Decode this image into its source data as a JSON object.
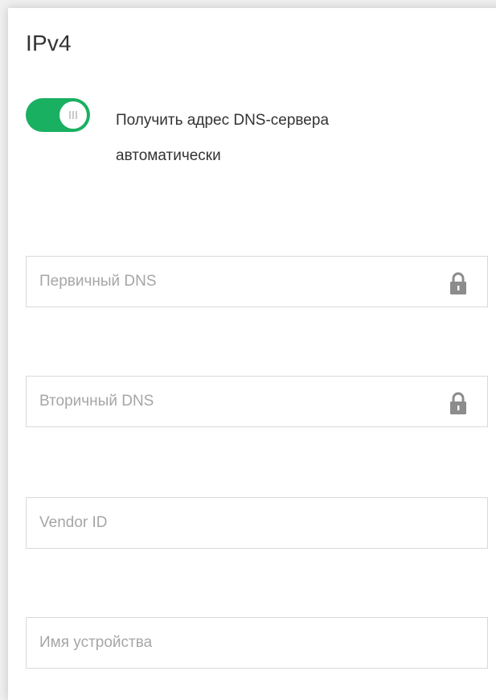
{
  "section": {
    "title": "IPv4"
  },
  "auto_dns": {
    "label": "Получить адрес DNS-сервера автоматически",
    "enabled": true,
    "accent_color": "#1ab061"
  },
  "fields": {
    "primary_dns": {
      "placeholder": "Первичный DNS",
      "value": "",
      "locked": true,
      "icon": "lock-icon"
    },
    "secondary_dns": {
      "placeholder": "Вторичный DNS",
      "value": "",
      "locked": true,
      "icon": "lock-icon"
    },
    "vendor_id": {
      "placeholder": "Vendor ID",
      "value": ""
    },
    "device_name": {
      "placeholder": "Имя устройства",
      "value": ""
    }
  }
}
